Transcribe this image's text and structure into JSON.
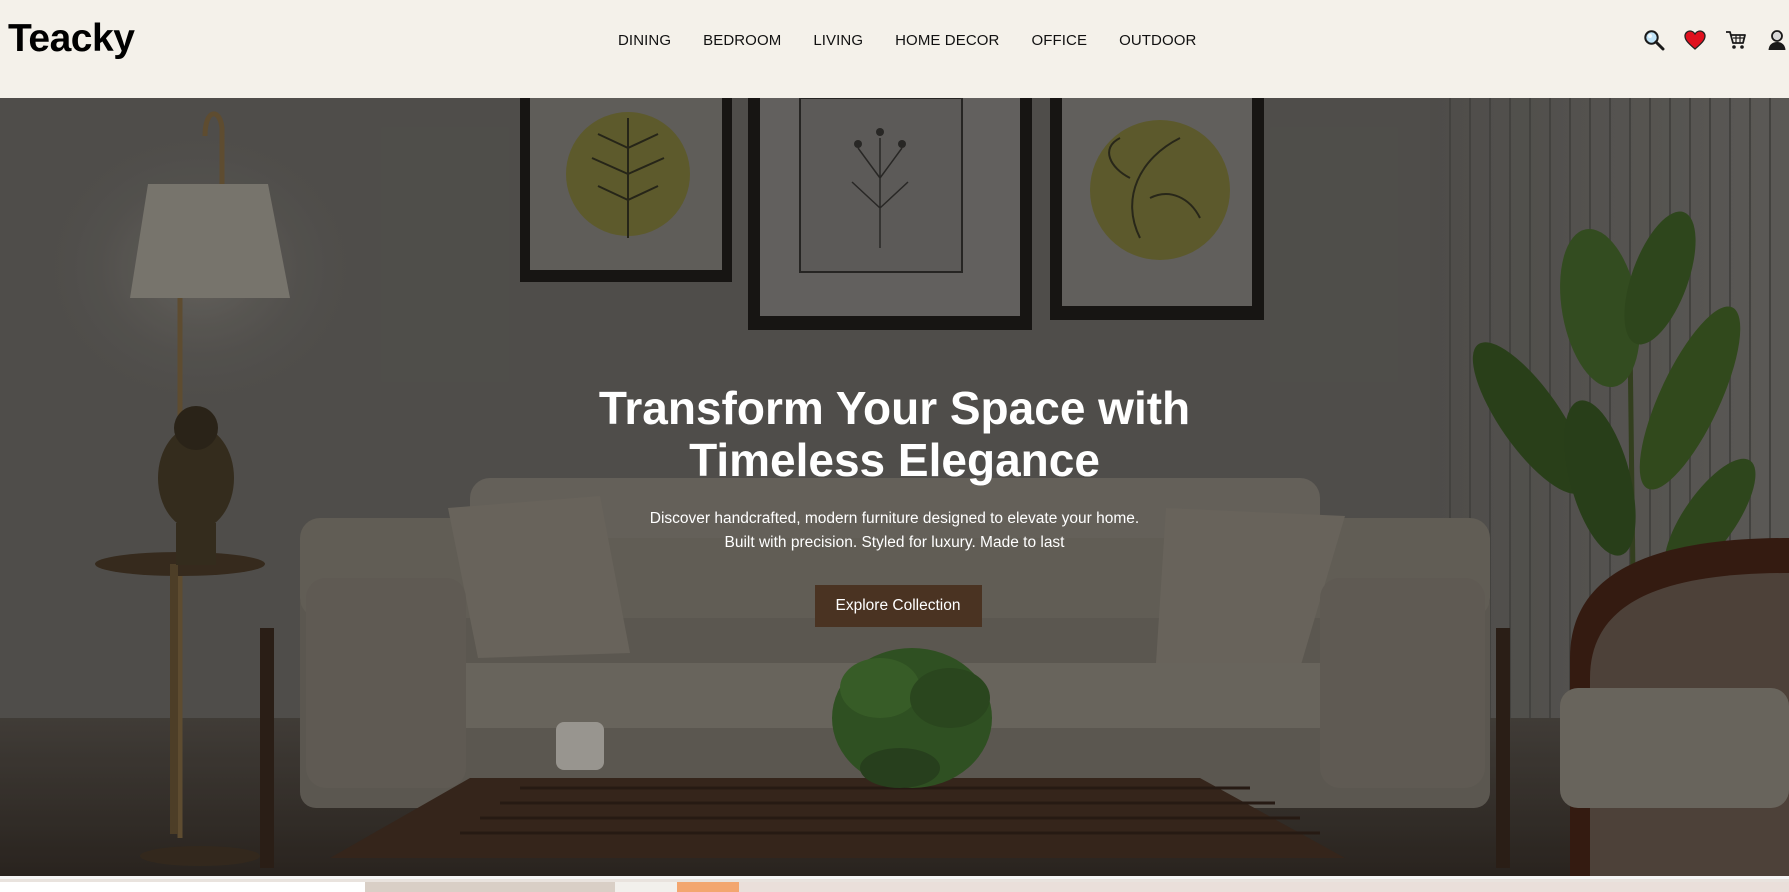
{
  "brand": {
    "name": "Teacky"
  },
  "nav": {
    "items": [
      {
        "label": "DINING"
      },
      {
        "label": "BEDROOM"
      },
      {
        "label": "LIVING"
      },
      {
        "label": "HOME DECOR"
      },
      {
        "label": "OFFICE"
      },
      {
        "label": "OUTDOOR"
      }
    ]
  },
  "header_icons": [
    {
      "name": "search-icon"
    },
    {
      "name": "heart-icon",
      "color": "#e0101e"
    },
    {
      "name": "cart-icon"
    },
    {
      "name": "user-icon"
    }
  ],
  "hero": {
    "title": "Transform Your Space with Timeless Elegance",
    "subtitle_line1": "Discover handcrafted, modern furniture designed to elevate your home.",
    "subtitle_line2": "Built with precision. Styled for luxury. Made to last",
    "cta_label": "Explore Collection",
    "cta_color": "#4a3322"
  },
  "colors": {
    "header_bg": "#f4f1ea",
    "hero_text": "#ffffff"
  }
}
